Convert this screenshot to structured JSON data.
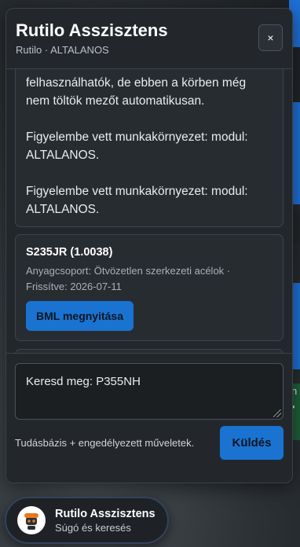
{
  "panel": {
    "title": "Rutilo Asszisztens",
    "subtitle": "Rutilo · ALTALANOS",
    "close_label": "×"
  },
  "messages": {
    "text_message": {
      "partial_line": "felhasználhatók, de ebben a körben még nem töltök mezőt automatikusan.",
      "context_1": "Figyelembe vett munkakörnyezet: modul: ALTALANOS.",
      "context_2": "Figyelembe vett munkakörnyezet: modul: ALTALANOS."
    },
    "result": {
      "title": "S235JR (1.0038)",
      "meta": "Anyagcsoport: Ötvözetlen szerkezeti acélok · Frissítve: 2026-07-11",
      "button_label": "BML megnyitása"
    }
  },
  "composer": {
    "input_value": "Keresd meg: P355NH",
    "hint": "Tudásbázis + engedélyezett műveletek.",
    "send_label": "Küldés"
  },
  "launcher": {
    "title": "Rutilo Asszisztens",
    "subtitle": "Súgó és keresés"
  },
  "colors": {
    "accent": "#1a73d1",
    "panel_bg": "#23272b",
    "card_bg": "#272c31"
  }
}
